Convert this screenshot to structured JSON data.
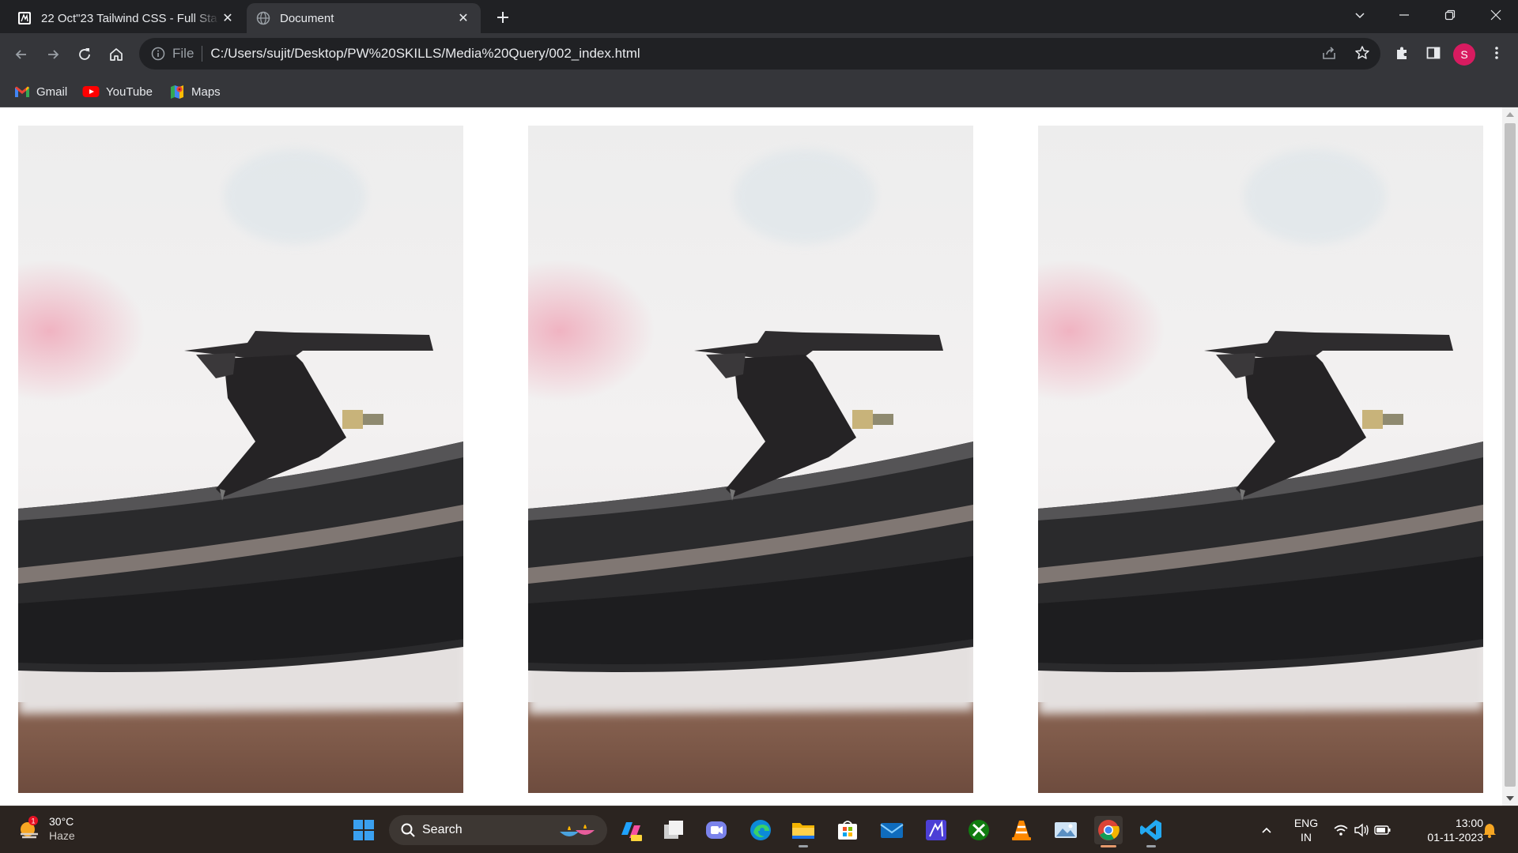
{
  "browser": {
    "tabs": [
      {
        "title": "22 Oct\"23 Tailwind CSS - Full Sta",
        "favicon": "webpage-favicon-icon",
        "active": false
      },
      {
        "title": "Document",
        "favicon": "globe-icon",
        "active": true
      }
    ],
    "address": {
      "scheme_label": "File",
      "url": "C:/Users/sujit/Desktop/PW%20SKILLS/Media%20Query/002_index.html"
    },
    "profile_initial": "S",
    "bookmarks": [
      {
        "label": "Gmail",
        "icon": "gmail-icon"
      },
      {
        "label": "YouTube",
        "icon": "youtube-icon"
      },
      {
        "label": "Maps",
        "icon": "maps-icon"
      }
    ]
  },
  "page": {
    "images": [
      {
        "subject": "turntable-stylus-photo"
      },
      {
        "subject": "turntable-stylus-photo"
      },
      {
        "subject": "turntable-stylus-photo"
      }
    ]
  },
  "taskbar": {
    "weather": {
      "temperature": "30°C",
      "condition": "Haze",
      "badge": "1"
    },
    "search_placeholder": "Search",
    "language": {
      "line1": "ENG",
      "line2": "IN"
    },
    "clock": {
      "time": "13:00",
      "date": "01-11-2023"
    },
    "accent_color": "#e59a6c"
  },
  "colors": {
    "tab_strip": "#202124",
    "toolbar": "#35363a",
    "taskbar": "#2b2420"
  }
}
